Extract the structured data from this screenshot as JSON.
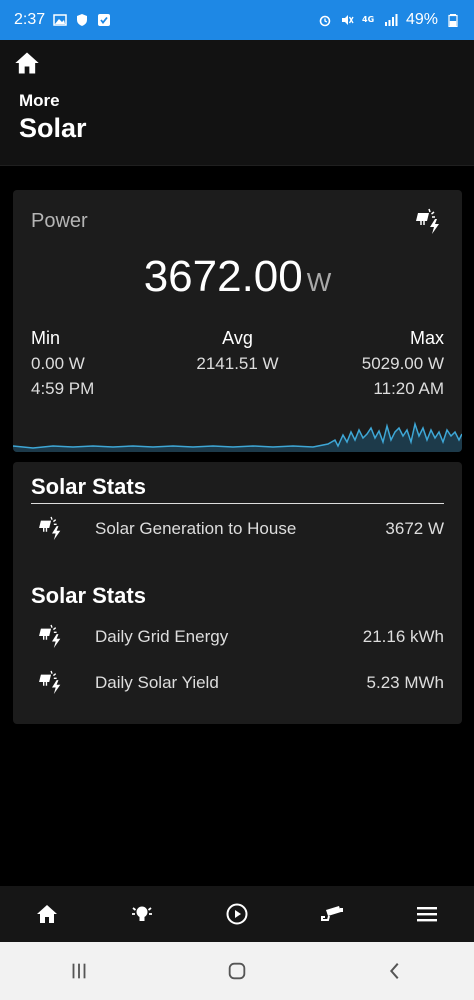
{
  "status_bar": {
    "time": "2:37",
    "battery": "49%",
    "left_icons": [
      "image-icon",
      "shield-icon",
      "check-box-icon"
    ],
    "right_icons": [
      "alarm-icon",
      "mute-icon",
      "4g-icon",
      "signal-icon",
      "battery-icon"
    ]
  },
  "header": {
    "subtitle": "More",
    "title": "Solar"
  },
  "power_card": {
    "label": "Power",
    "value": "3672.00",
    "unit": "W",
    "min_label": "Min",
    "min_value": "0.00 W",
    "min_time": "4:59 PM",
    "avg_label": "Avg",
    "avg_value": "2141.51 W",
    "max_label": "Max",
    "max_value": "5029.00 W",
    "max_time": "11:20 AM",
    "accent_color": "#3ea7d6"
  },
  "stats": {
    "section1_title": "Solar Stats",
    "section2_title": "Solar Stats",
    "rows": [
      {
        "label": "Solar Generation to House",
        "value": "3672 W"
      },
      {
        "label": "Daily Grid Energy",
        "value": "21.16 kWh"
      },
      {
        "label": "Daily Solar Yield",
        "value": "5.23 MWh"
      }
    ]
  },
  "bottom_nav": [
    "home-icon",
    "lights-icon",
    "play-icon",
    "camera-icon",
    "menu-icon"
  ],
  "system_nav": [
    "recents-icon",
    "home-circle-icon",
    "back-icon"
  ]
}
